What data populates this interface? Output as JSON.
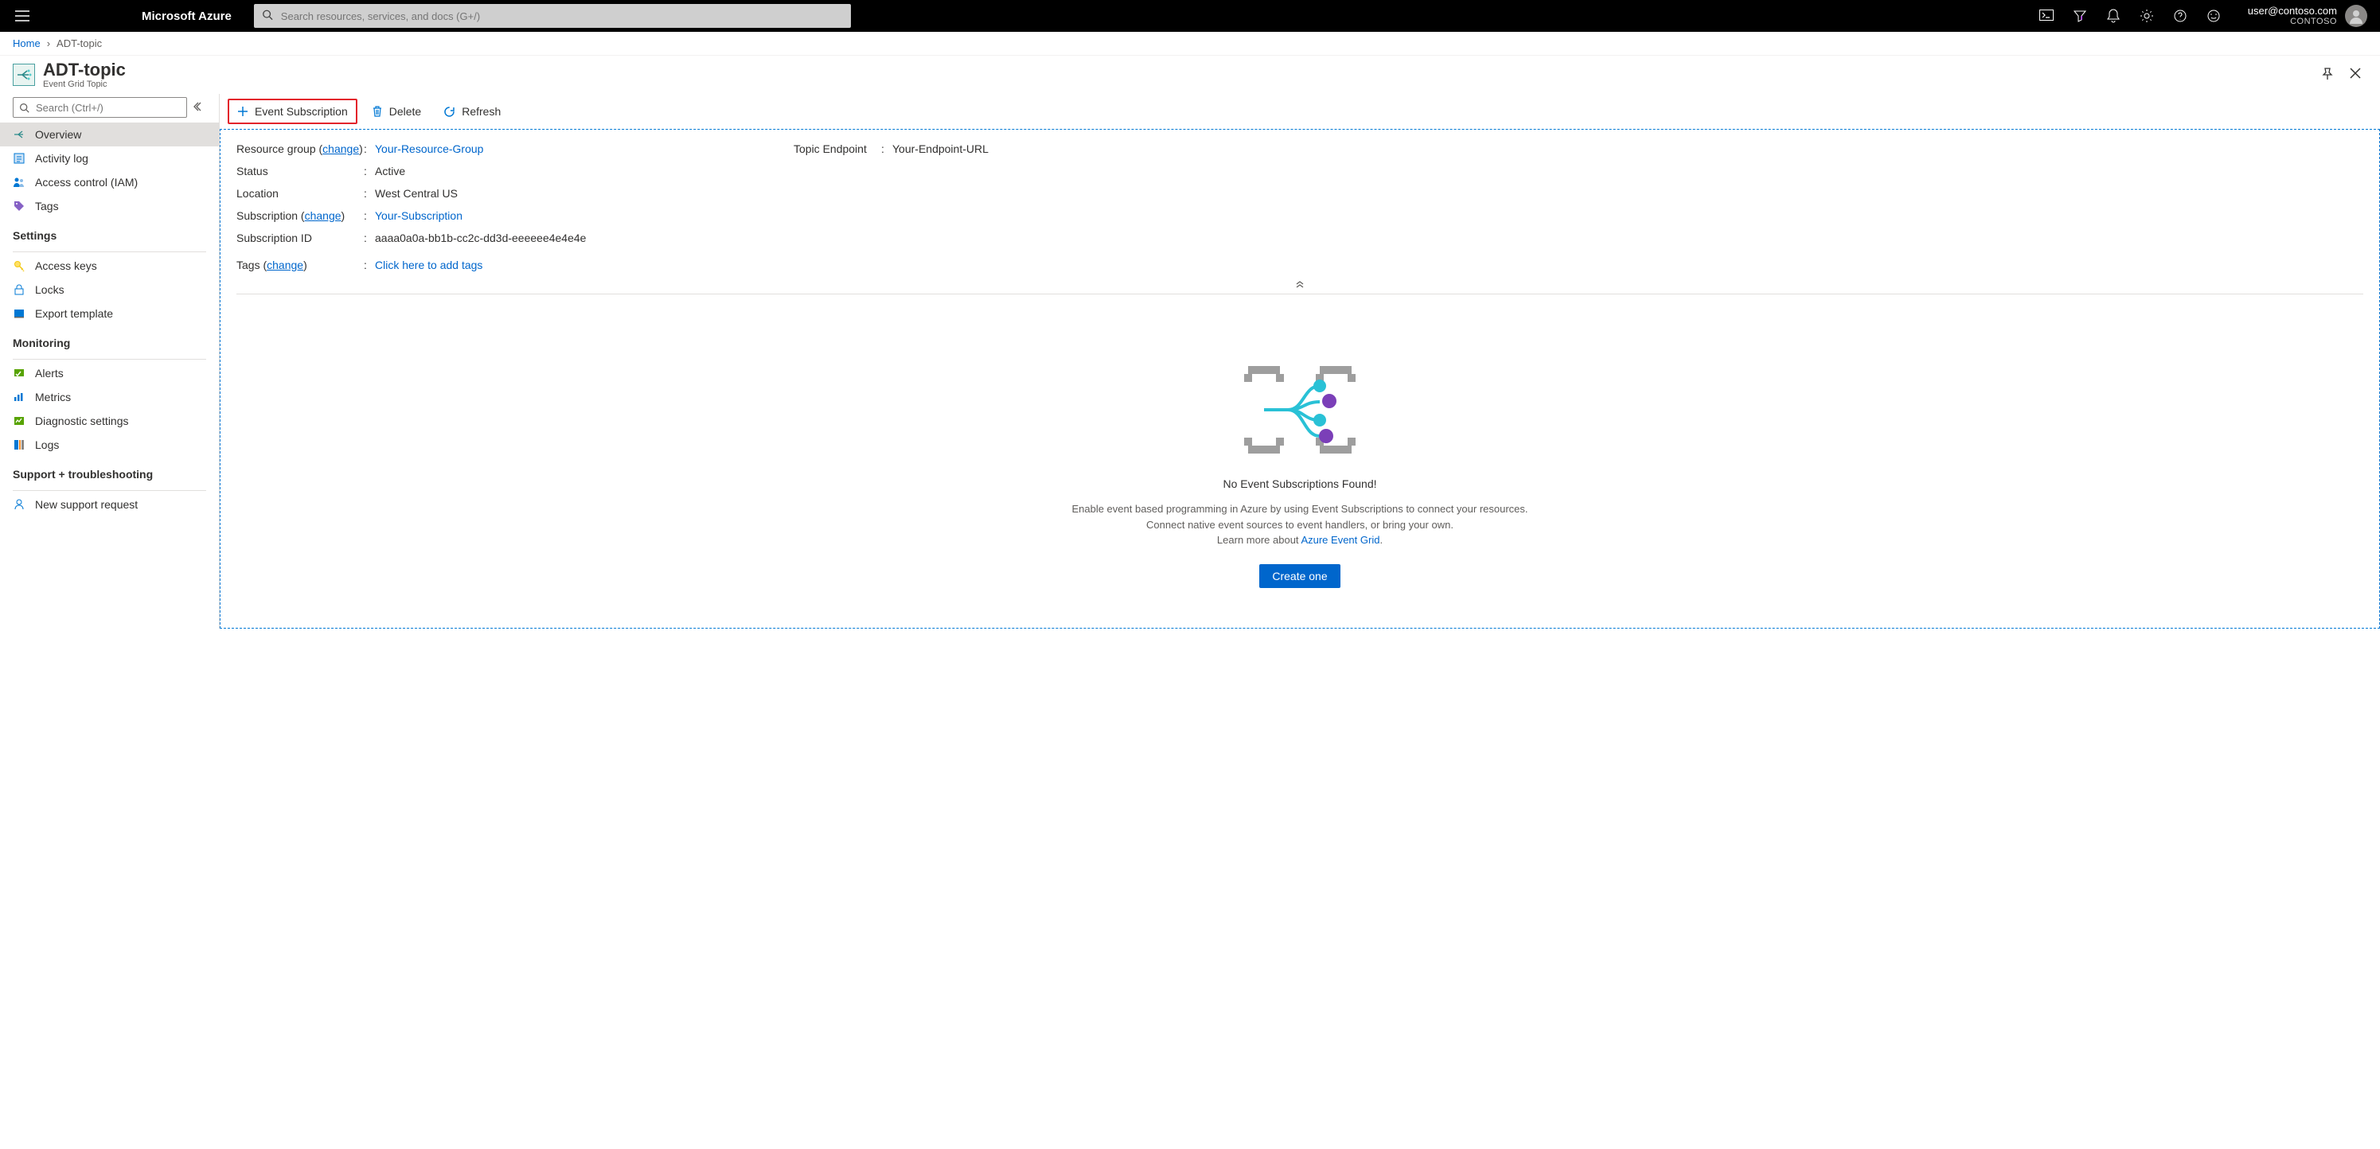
{
  "topbar": {
    "brand": "Microsoft Azure",
    "search_placeholder": "Search resources, services, and docs (G+/)",
    "user_email": "user@contoso.com",
    "user_tenant": "CONTOSO"
  },
  "breadcrumb": {
    "home": "Home",
    "current": "ADT-topic"
  },
  "title": {
    "name": "ADT-topic",
    "type": "Event Grid Topic"
  },
  "nav": {
    "search_placeholder": "Search (Ctrl+/)",
    "items": {
      "overview": "Overview",
      "activity": "Activity log",
      "iam": "Access control (IAM)",
      "tags": "Tags"
    },
    "settings_header": "Settings",
    "settings": {
      "keys": "Access keys",
      "locks": "Locks",
      "export": "Export template"
    },
    "monitoring_header": "Monitoring",
    "monitoring": {
      "alerts": "Alerts",
      "metrics": "Metrics",
      "diag": "Diagnostic settings",
      "logs": "Logs"
    },
    "support_header": "Support + troubleshooting",
    "support": {
      "request": "New support request"
    }
  },
  "cmdbar": {
    "event_sub": "Event Subscription",
    "delete": "Delete",
    "refresh": "Refresh"
  },
  "essentials": {
    "rg_label": "Resource group (",
    "change": "change",
    "rg_label_close": ")",
    "rg_value": "Your-Resource-Group",
    "status_label": "Status",
    "status_value": "Active",
    "location_label": "Location",
    "location_value": "West Central US",
    "sub_label": "Subscription (",
    "sub_value": "Your-Subscription",
    "subid_label": "Subscription ID",
    "subid_value": "aaaa0a0a-bb1b-cc2c-dd3d-eeeeee4e4e4e",
    "tags_label": "Tags (",
    "tags_value": "Click here to add tags",
    "endpoint_label": "Topic Endpoint",
    "endpoint_value": "Your-Endpoint-URL"
  },
  "empty": {
    "title": "No Event Subscriptions Found!",
    "desc1": "Enable event based programming in Azure by using Event Subscriptions to connect your resources.",
    "desc2": "Connect native event sources to event handlers, or bring your own.",
    "desc3a": "Learn more about ",
    "desc3link": "Azure Event Grid",
    "button": "Create one"
  }
}
